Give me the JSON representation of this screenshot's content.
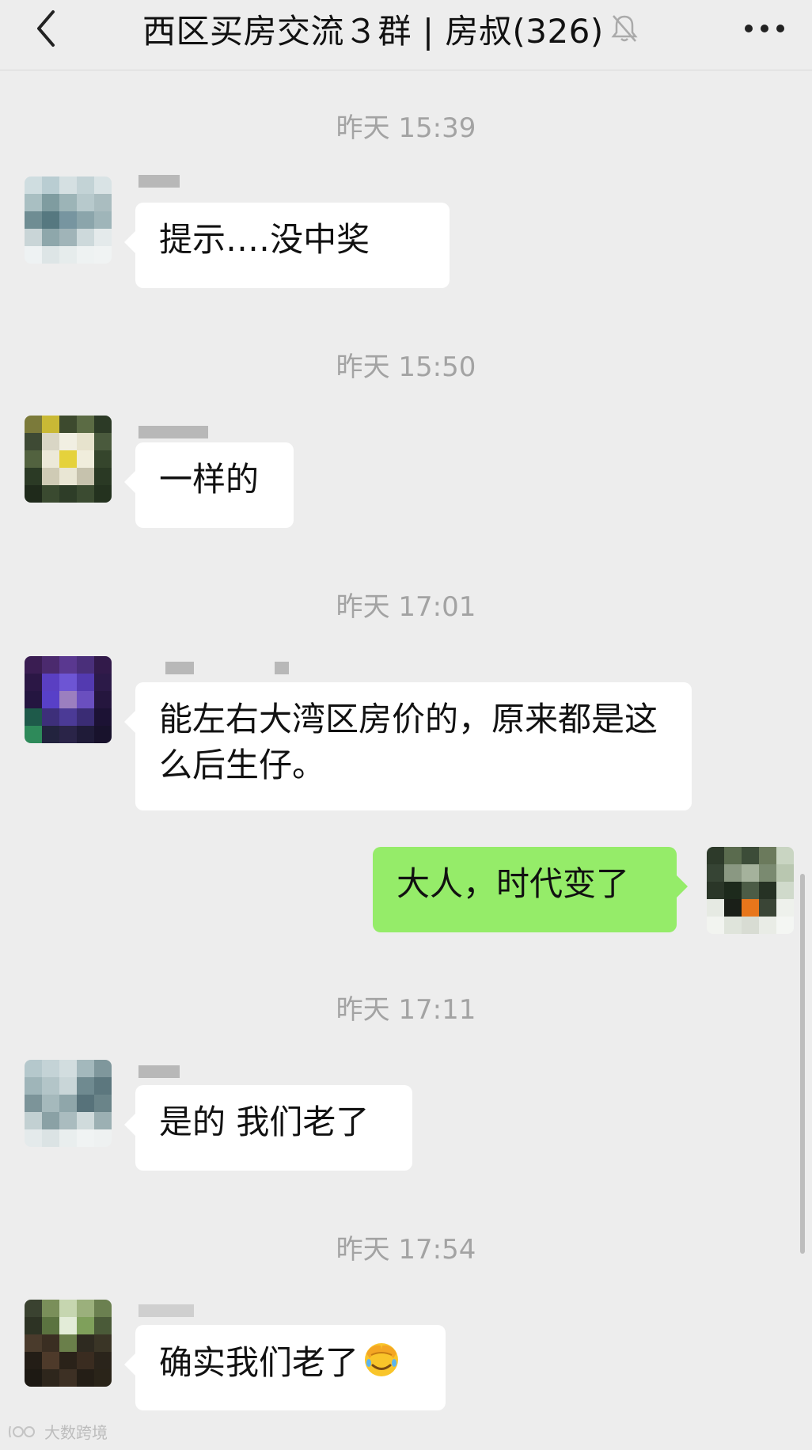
{
  "nav": {
    "title": "西区买房交流３群 | 房叔(326)",
    "back_icon": "chevron-left-icon",
    "mute_icon": "bell-off-icon",
    "more_icon": "ellipsis-icon"
  },
  "chat": {
    "time_dividers": [
      "昨天 15:39",
      "昨天 15:50",
      "昨天 17:01",
      "昨天 17:11",
      "昨天 17:54"
    ],
    "messages": [
      {
        "side": "left",
        "text": "提示‥‥没中奖"
      },
      {
        "side": "left",
        "text": "一样的"
      },
      {
        "side": "left",
        "text": "能左右大湾区房价的，原来都是这么后生仔。"
      },
      {
        "side": "right",
        "text": "大人，时代变了"
      },
      {
        "side": "left",
        "text": "是的 我们老了"
      },
      {
        "side": "left",
        "text": "确实我们老了",
        "emoji": "facepalm-emoji-icon"
      }
    ]
  },
  "watermark": {
    "text": "大数跨境"
  },
  "colors": {
    "background": "#ededed",
    "bubble_incoming": "#ffffff",
    "bubble_outgoing": "#95ec69",
    "time_text": "#a3a3a3"
  }
}
